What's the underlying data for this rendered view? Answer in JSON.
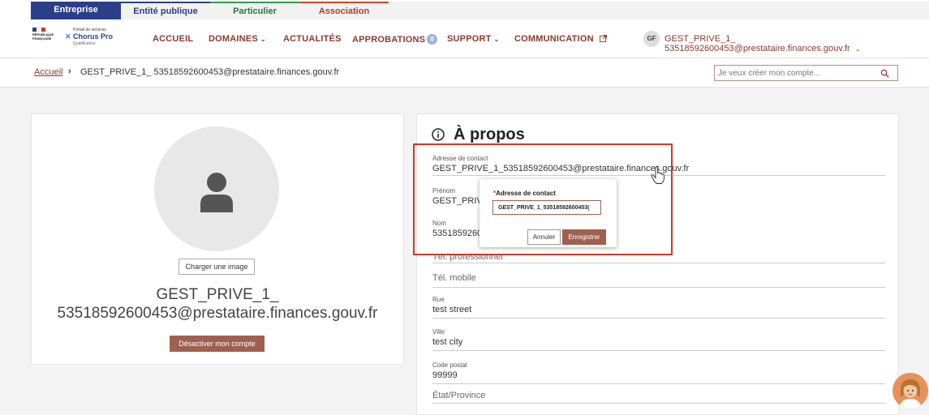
{
  "top_tabs": {
    "entreprise": "Entreprise",
    "entite_publique": "Entité publique",
    "particulier": "Particulier",
    "association": "Association"
  },
  "logo": {
    "rf_line1": "RÉPUBLIQUE",
    "rf_line2": "FRANÇAISE",
    "portal_small": "Portail de services",
    "portal_name": "Chorus Pro",
    "portal_env": "Qualification"
  },
  "nav": {
    "accueil": "ACCUEIL",
    "domaines": "DOMAINES",
    "actualites": "ACTUALITÉS",
    "approbations": "APPROBATIONS",
    "approbations_count": "0",
    "support": "SUPPORT",
    "communication": "COMMUNICATION"
  },
  "user": {
    "initials": "GF",
    "name": "GEST_PRIVE_1_ 53518592600453@prestataire.finances.gouv.fr"
  },
  "breadcrumb": {
    "home": "Accueil",
    "separator": "›",
    "current": "GEST_PRIVE_1_ 53518592600453@prestataire.finances.gouv.fr"
  },
  "search": {
    "placeholder": "Je veux créer mon compte..."
  },
  "profile": {
    "upload_label": "Charger une image",
    "display_line1": "GEST_PRIVE_1_",
    "display_line2": "53518592600453@prestataire.finances.gouv.fr",
    "deactivate_label": "Désactiver mon compte"
  },
  "about": {
    "title": "À propos",
    "fields": {
      "contact_label": "Adresse de contact",
      "contact_value": "GEST_PRIVE_1_53518592600453@prestataire.finances.gouv.fr",
      "prenom_label": "Prénom",
      "prenom_value": "GEST_PRIVE",
      "nom_label": "Nom",
      "nom_value": "53518592600",
      "tel_pro": "Tél. professionnel",
      "tel_mobile": "Tél. mobile",
      "rue_label": "Rue",
      "rue_value": "test street",
      "ville_label": "Ville",
      "ville_value": "test city",
      "cp_label": "Code postal",
      "cp_value": "99999",
      "etat": "État/Province"
    }
  },
  "popup": {
    "required_mark": "*",
    "label": "Adresse de contact",
    "input_value": "GEST_PRIVE_1_53518592600453(",
    "cancel_label": "Annuler",
    "save_label": "Enregistrer"
  },
  "colors": {
    "brand_blue": "#2b3e8a",
    "accent_brown": "#8b3a2e",
    "button_brown": "#a0604f",
    "highlight_red": "#d0372a"
  }
}
